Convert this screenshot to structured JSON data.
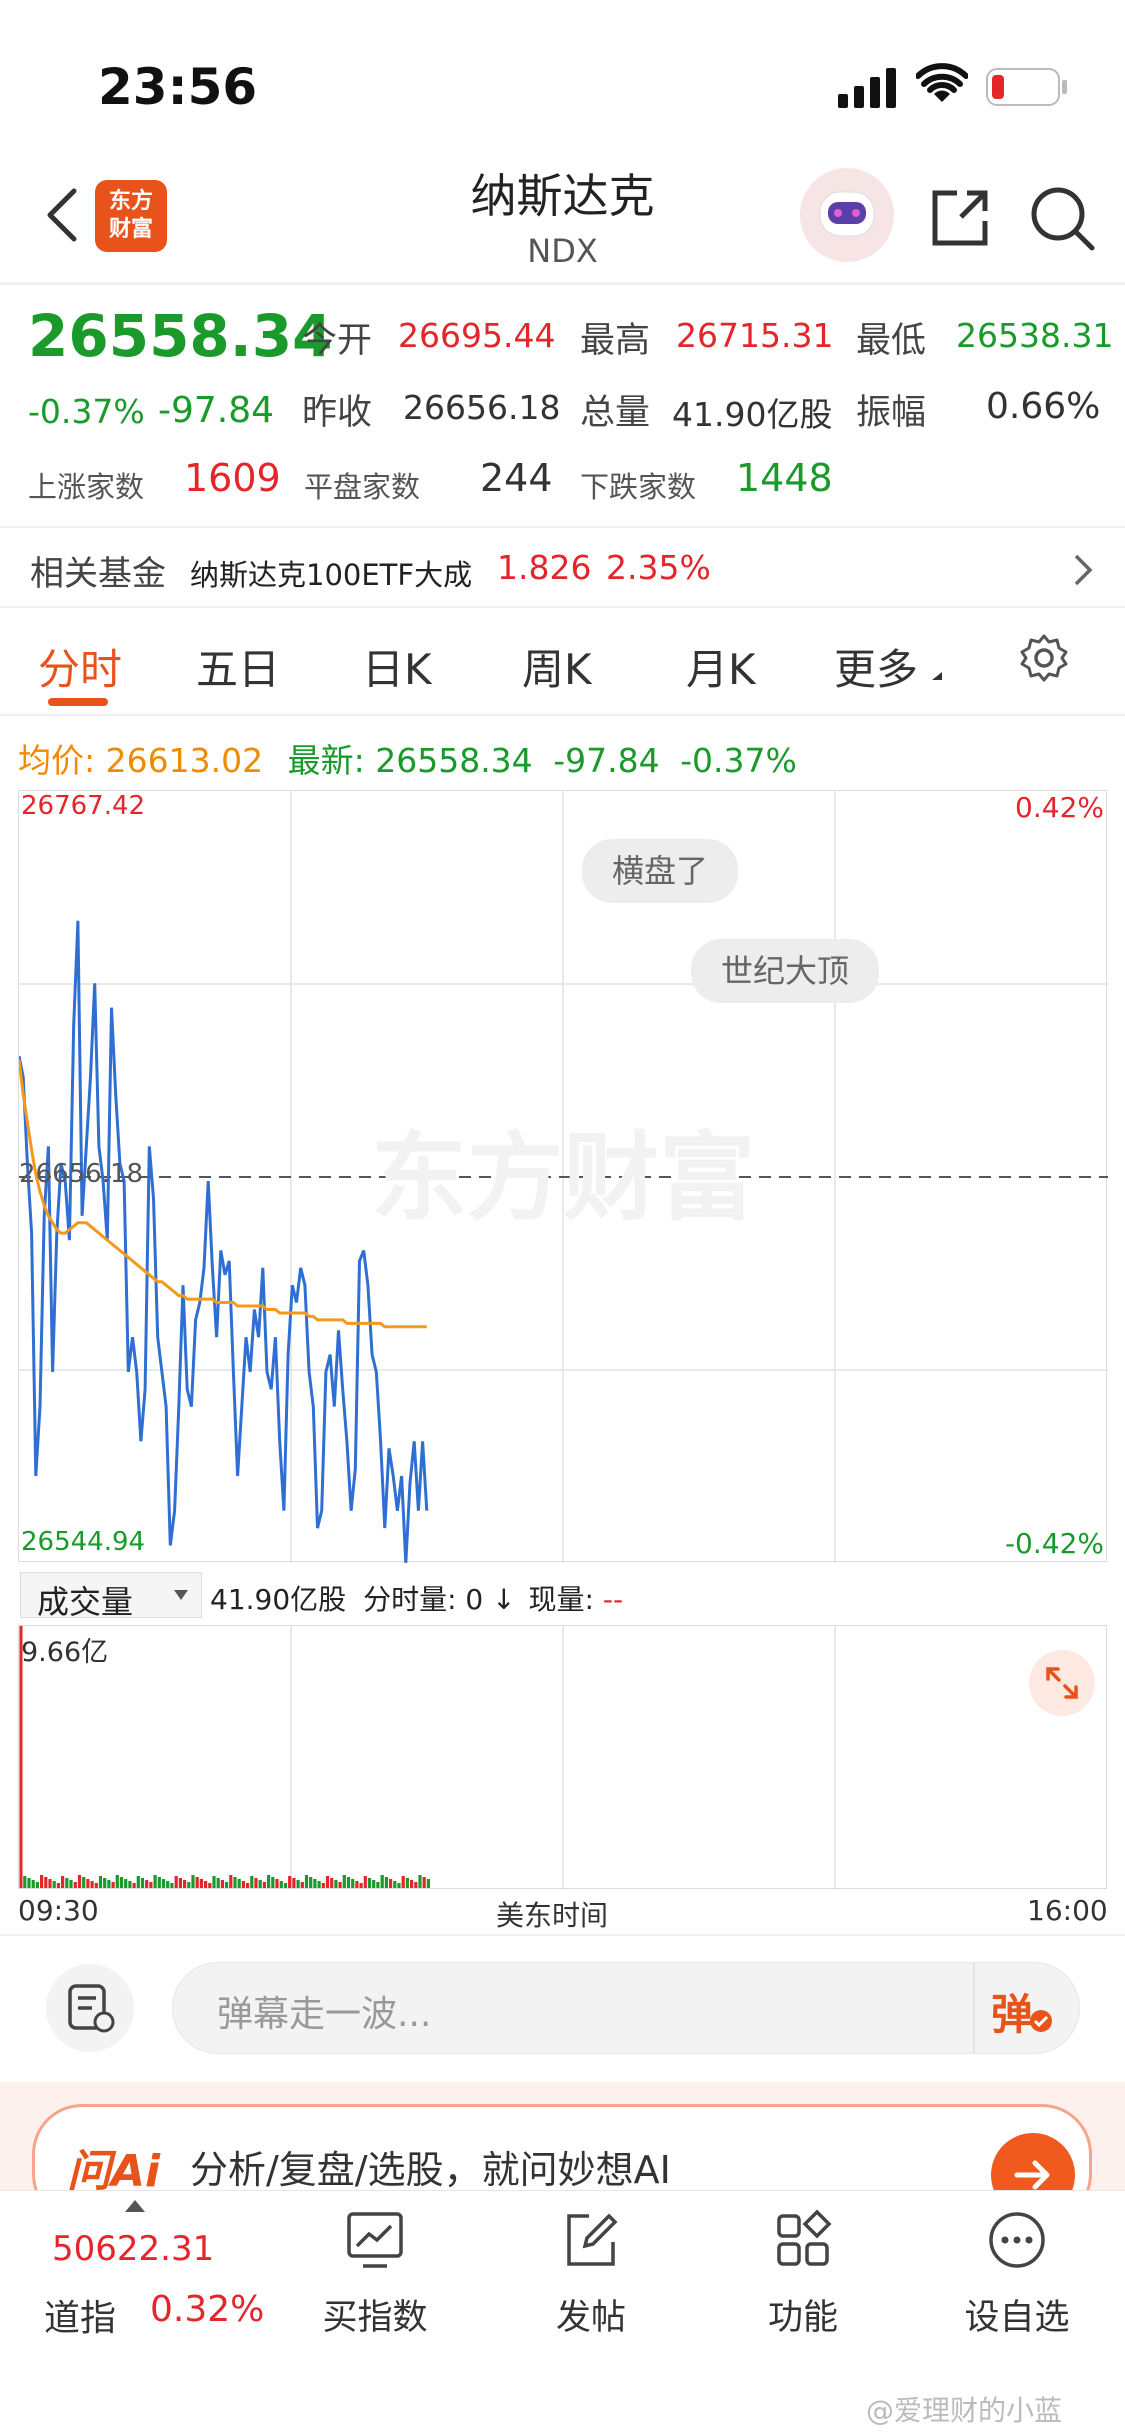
{
  "status_bar": {
    "time": "23:56"
  },
  "header": {
    "logo_line1": "东方",
    "logo_line2": "财富",
    "title": "纳斯达克",
    "subtitle": "NDX"
  },
  "quote": {
    "price": "26558.34",
    "change_pct": "-0.37%",
    "change": "-97.84",
    "open_label": "今开",
    "open": "26695.44",
    "high_label": "最高",
    "high": "26715.31",
    "low_label": "最低",
    "low": "26538.31",
    "prev_close_label": "昨收",
    "prev_close": "26656.18",
    "volume_label": "总量",
    "volume": "41.90亿股",
    "amplitude_label": "振幅",
    "amplitude": "0.66%",
    "up_label": "上涨家数",
    "up": "1609",
    "flat_label": "平盘家数",
    "flat": "244",
    "down_label": "下跌家数",
    "down": "1448"
  },
  "fund": {
    "label": "相关基金",
    "name": "纳斯达克100ETF大成",
    "price": "1.826",
    "change": "2.35%"
  },
  "tabs": [
    {
      "label": "分时",
      "active": true
    },
    {
      "label": "五日"
    },
    {
      "label": "日K"
    },
    {
      "label": "周K"
    },
    {
      "label": "月K"
    },
    {
      "label": "更多"
    }
  ],
  "info_line": {
    "avg_label": "均价:",
    "avg": "26613.02",
    "latest_label": "最新:",
    "latest": "26558.34",
    "change": "-97.84",
    "change_pct": "-0.37%"
  },
  "chart_data": {
    "type": "line",
    "ylim": [
      26544.94,
      26767.42
    ],
    "y_top_label": "26767.42",
    "y_mid_label": "26656.18",
    "y_bottom_label": "26544.94",
    "pct_top": "0.42%",
    "pct_bottom": "-0.42%",
    "x_start": "09:30",
    "x_mid": "美东时间",
    "x_end": "16:00",
    "watermark": "东方财富",
    "price_series": [
      26691,
      26685,
      26660,
      26640,
      26570,
      26590,
      26645,
      26665,
      26600,
      26640,
      26660,
      26655,
      26638,
      26700,
      26730,
      26645,
      26665,
      26685,
      26712,
      26665,
      26655,
      26638,
      26705,
      26680,
      26660,
      26655,
      26600,
      26610,
      26600,
      26580,
      26595,
      26665,
      26650,
      26610,
      26600,
      26590,
      26550,
      26560,
      26590,
      26625,
      26595,
      26590,
      26615,
      26620,
      26630,
      26655,
      26630,
      26610,
      26635,
      26628,
      26632,
      26600,
      26570,
      26590,
      26610,
      26600,
      26618,
      26610,
      26630,
      26600,
      26595,
      26610,
      26580,
      26560,
      26605,
      26625,
      26620,
      26630,
      26625,
      26600,
      26590,
      26555,
      26560,
      26600,
      26605,
      26590,
      26612,
      26595,
      26580,
      26560,
      26572,
      26632,
      26635,
      26625,
      26605,
      26600,
      26580,
      26555,
      26578,
      26570,
      26560,
      26570,
      26545,
      26568,
      26580,
      26560,
      26580,
      26560
    ],
    "avg_series": [
      26690,
      26680,
      26672,
      26664,
      26657,
      26652,
      26648,
      26645,
      26643,
      26641,
      26640,
      26640,
      26641,
      26642,
      26643,
      26643,
      26643,
      26642,
      26641,
      26640,
      26639,
      26638,
      26637,
      26636,
      26635,
      26634,
      26633,
      26632,
      26631,
      26630,
      26629,
      26628,
      26627,
      26626,
      26626,
      26625,
      26624,
      26623,
      26622,
      26622,
      26621,
      26621,
      26621,
      26621,
      26621,
      26621,
      26621,
      26620,
      26620,
      26620,
      26620,
      26620,
      26619,
      26619,
      26619,
      26619,
      26619,
      26619,
      26619,
      26618,
      26618,
      26618,
      26617,
      26617,
      26617,
      26617,
      26617,
      26617,
      26617,
      26616,
      26616,
      26615,
      26615,
      26615,
      26615,
      26615,
      26615,
      26615,
      26614,
      26614,
      26614,
      26614,
      26614,
      26614,
      26614,
      26614,
      26614,
      26613,
      26613,
      26613,
      26613,
      26613,
      26613,
      26613,
      26613,
      26613,
      26613,
      26613
    ],
    "grid": true
  },
  "annotations": [
    "横盘了",
    "世纪大顶"
  ],
  "volume": {
    "selector": "成交量",
    "total": "41.90亿股",
    "tick_label": "分时量:",
    "tick_value": "0",
    "now_label": "现量:",
    "now_value": "--",
    "max_label": "9.66亿"
  },
  "comment": {
    "placeholder": "弹幕走一波...",
    "send": "弹"
  },
  "ai_banner": {
    "logo": "问Ai",
    "text": "分析/复盘/选股，就问妙想AI"
  },
  "bottom_nav": {
    "index_value": "50622.31",
    "index_name": "道指",
    "index_change": "0.32%",
    "items": [
      "买指数",
      "发帖",
      "功能",
      "设自选"
    ]
  },
  "watermark_user": "@爱理财的小蓝",
  "colors": {
    "red": "#e4262b",
    "green": "#1a9a2b",
    "orange": "#f08a00",
    "line_blue": "#2f6fd3",
    "accent": "#e8531c"
  }
}
